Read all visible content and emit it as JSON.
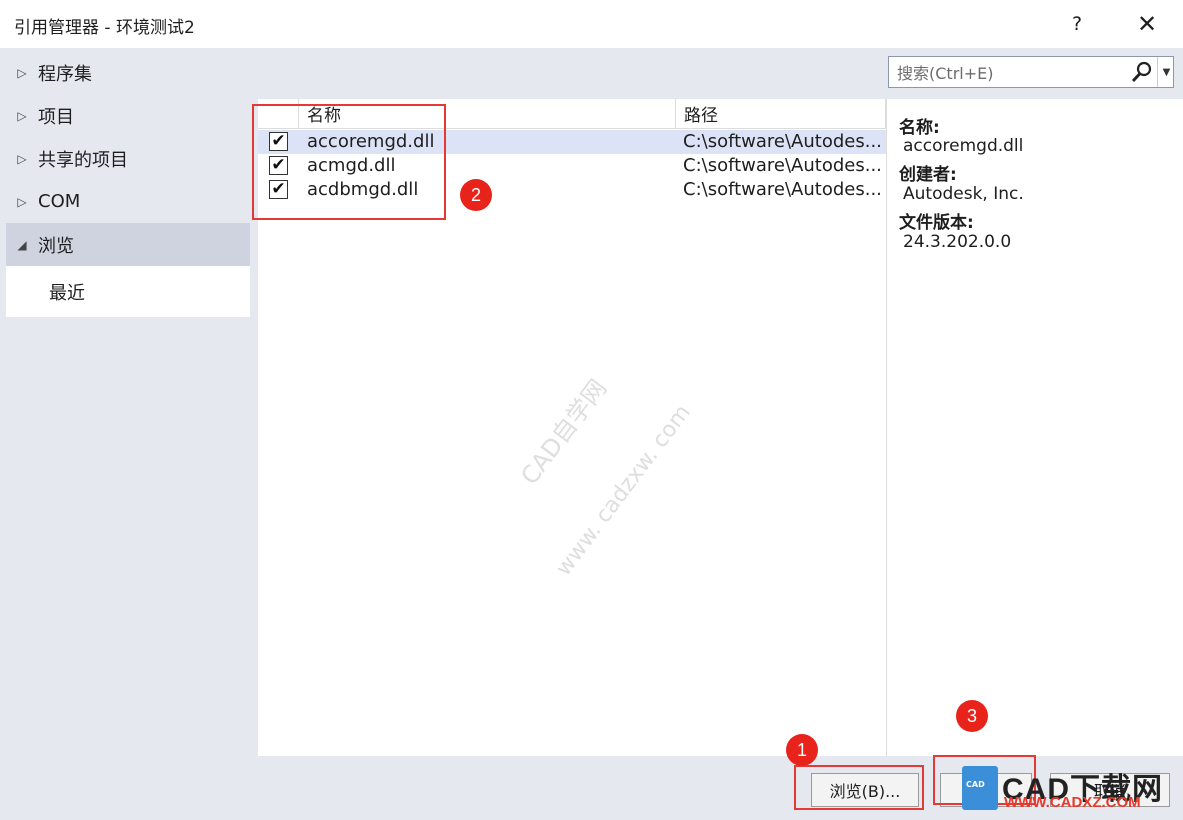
{
  "window": {
    "title": "引用管理器 - 环境测试2",
    "help_label": "?",
    "close_label": "✕"
  },
  "nav": {
    "items": [
      {
        "label": "程序集",
        "arrow": "▷"
      },
      {
        "label": "项目",
        "arrow": "▷"
      },
      {
        "label": "共享的项目",
        "arrow": "▷"
      },
      {
        "label": "COM",
        "arrow": "▷"
      },
      {
        "label": "浏览",
        "arrow": "◢"
      }
    ],
    "child": {
      "label": "最近"
    }
  },
  "search": {
    "placeholder": "搜索(Ctrl+E)"
  },
  "list": {
    "columns": [
      "名称",
      "路径"
    ],
    "rows": [
      {
        "checked": true,
        "name": "accoremgd.dll",
        "path": "C:\\software\\Autodes..."
      },
      {
        "checked": true,
        "name": "acmgd.dll",
        "path": "C:\\software\\Autodes..."
      },
      {
        "checked": true,
        "name": "acdbmgd.dll",
        "path": "C:\\software\\Autodes..."
      }
    ],
    "check_glyph": "✔"
  },
  "details": {
    "name_label": "名称:",
    "name_value": "accoremgd.dll",
    "creator_label": "创建者:",
    "creator_value": "Autodesk, Inc.",
    "version_label": "文件版本:",
    "version_value": "24.3.202.0.0"
  },
  "buttons": {
    "browse": "浏览(B)...",
    "cancel": "取消"
  },
  "annotations": {
    "badge1": "1",
    "badge2": "2",
    "badge3": "3",
    "color": "#e53935"
  },
  "watermark": {
    "line1": "CAD自学网",
    "line2": "www. cadzxw. com"
  },
  "logo": {
    "icon_text": "CAD",
    "main": "CAD下载网",
    "sub": "WWW.CADXZ.COM"
  }
}
